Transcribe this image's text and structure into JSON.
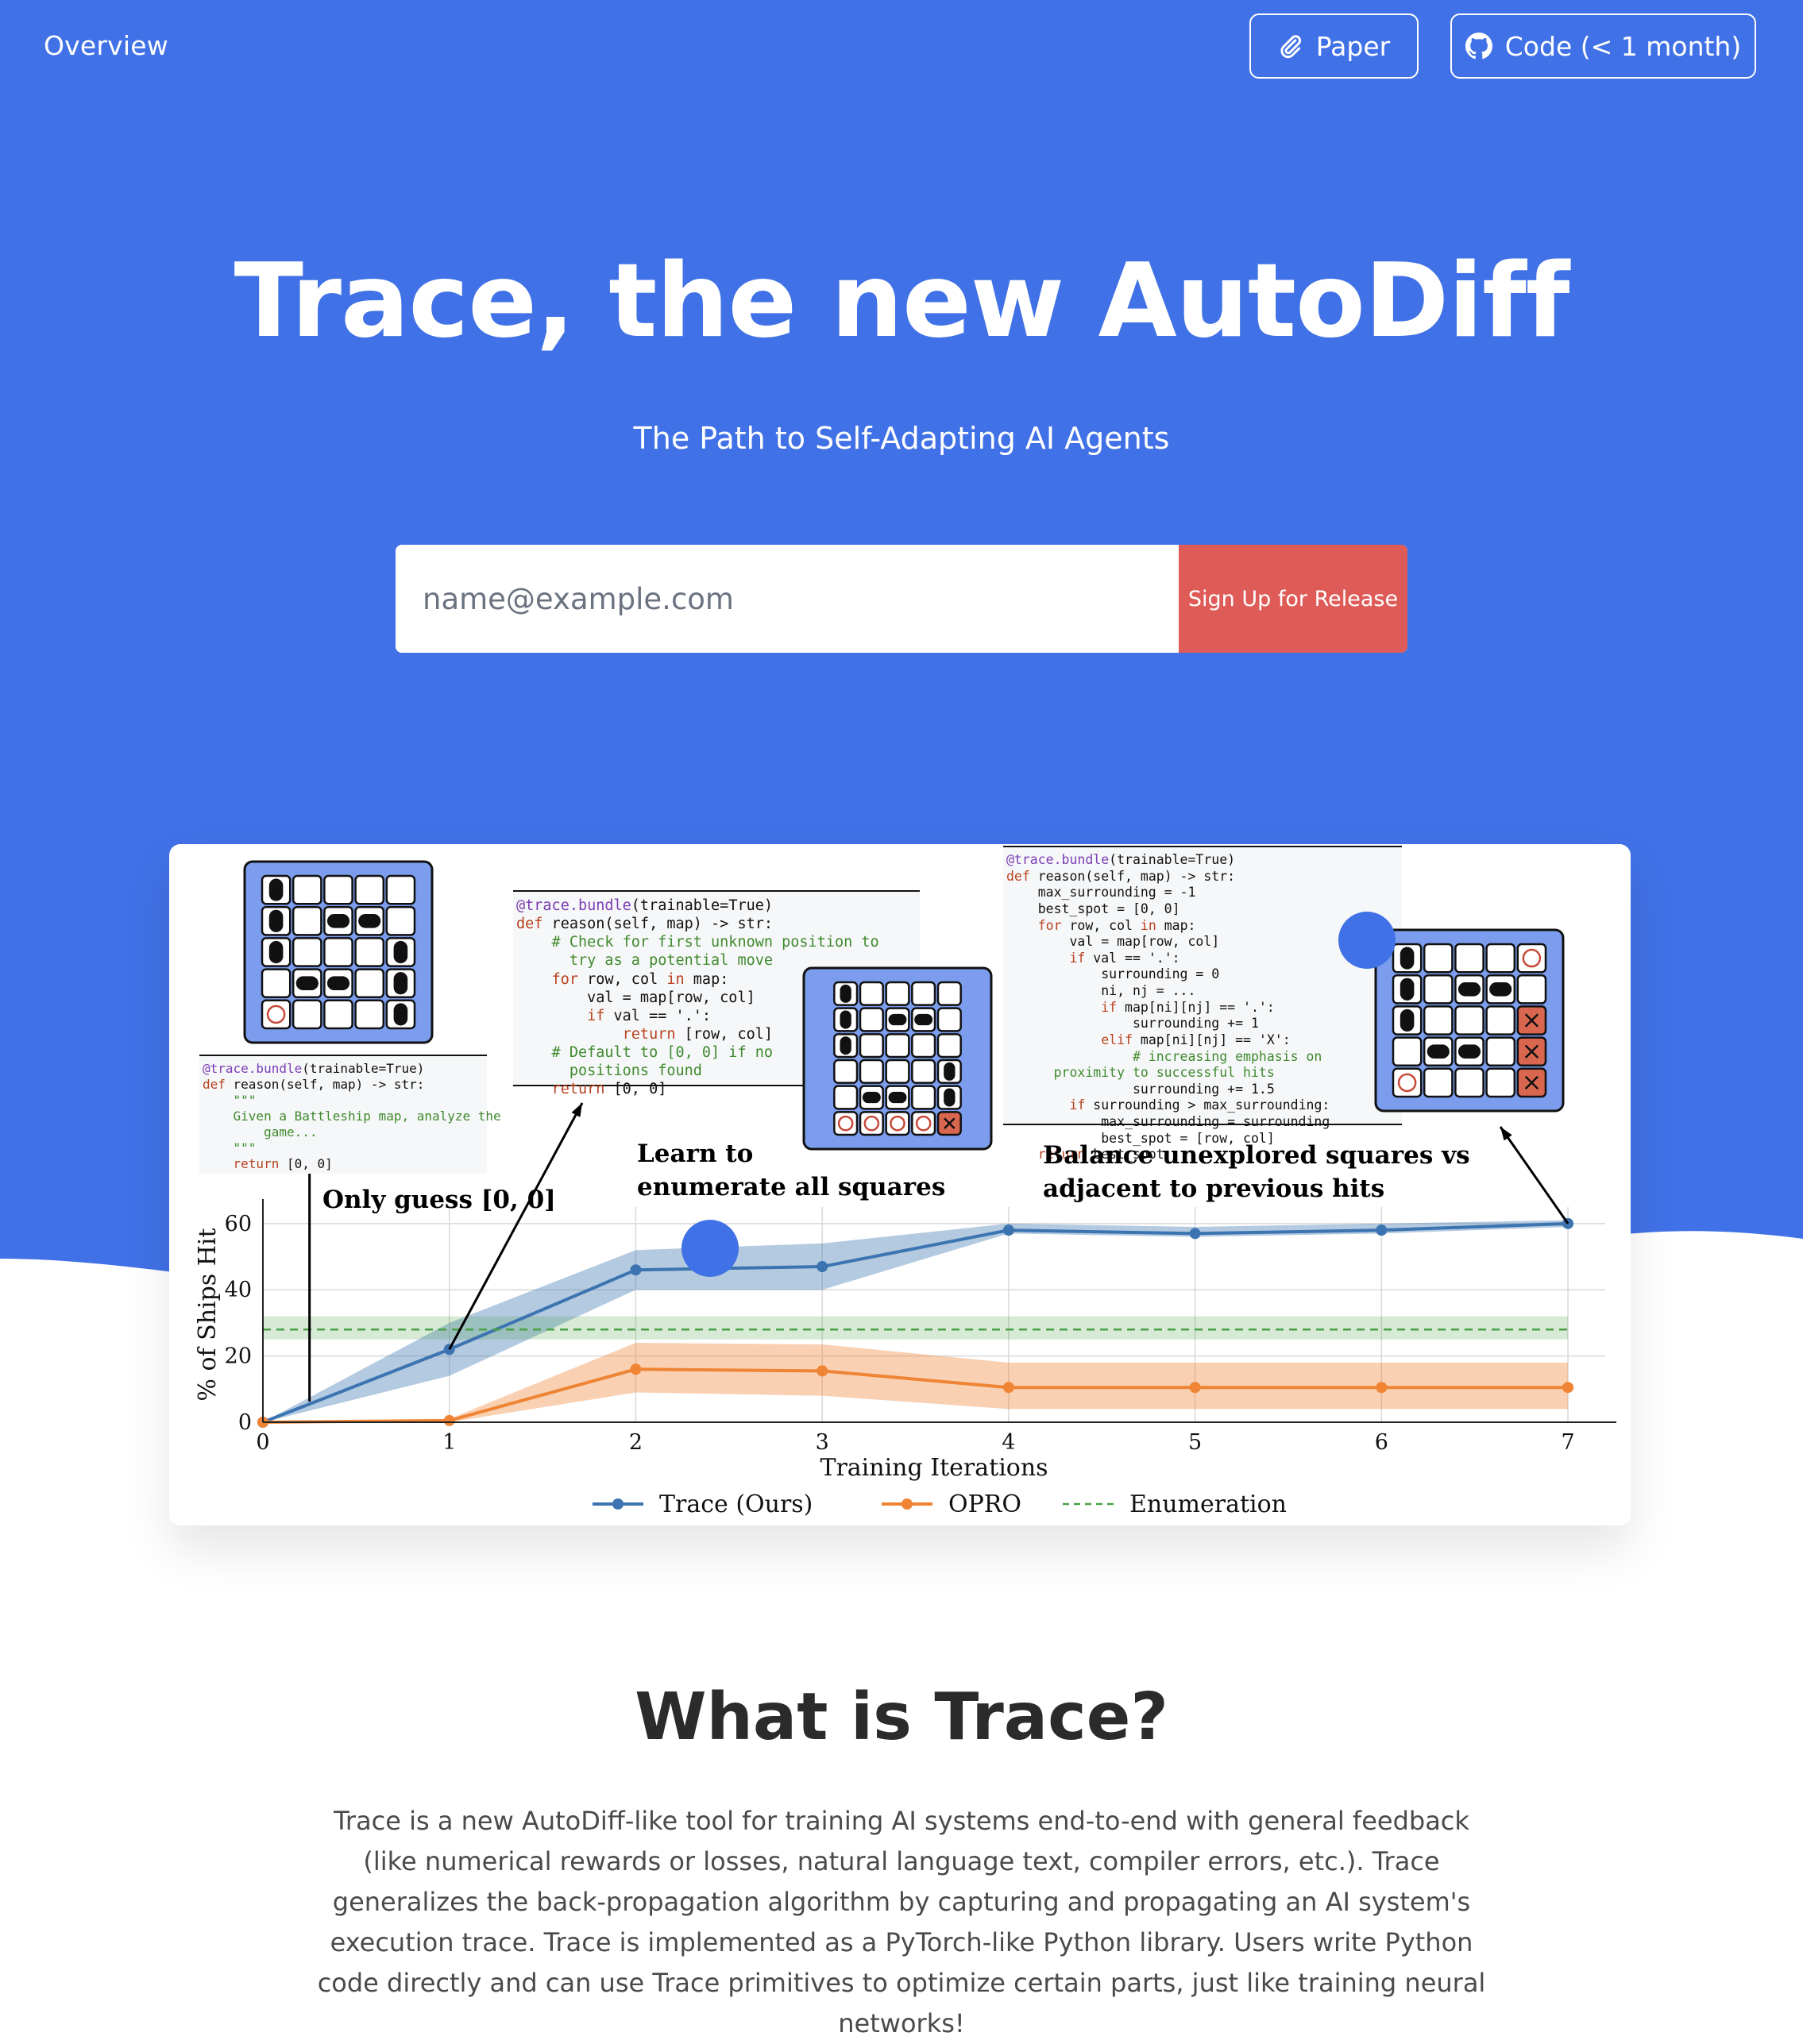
{
  "colors": {
    "hero_blue": "#4171e6",
    "cta_red": "#df5b57",
    "trace_blue": "#3b74b0",
    "opro_orange": "#ee8434",
    "enum_green": "#49a046"
  },
  "nav": {
    "overview": "Overview",
    "paper": {
      "label": "Paper",
      "icon": "paperclip-icon"
    },
    "code": {
      "label": "Code (< 1 month)",
      "icon": "github-icon"
    }
  },
  "hero": {
    "title": "Trace, the new AutoDiff",
    "subtitle": "The Path to Self-Adapting AI Agents",
    "email_placeholder": "name@example.com",
    "signup_button": "Sign Up for Release"
  },
  "figure": {
    "annotations": {
      "only_guess": "Only guess [0, 0]",
      "learn_1": "Learn to",
      "learn_2": "enumerate all squares",
      "balance_1": "Balance unexplored squares vs",
      "balance_2": "adjacent to previous hits"
    }
  },
  "chart_data": {
    "type": "line",
    "xlabel": "Training Iterations",
    "ylabel": "% of Ships Hit",
    "x": [
      0,
      1,
      2,
      3,
      4,
      5,
      6,
      7
    ],
    "xlim": [
      0,
      7.2
    ],
    "ylim": [
      0,
      65
    ],
    "yticks": [
      0,
      20,
      40,
      60
    ],
    "grid": true,
    "legend_position": "bottom",
    "series": [
      {
        "name": "Trace (Ours)",
        "values": [
          0,
          22,
          46,
          47,
          58,
          57,
          58,
          60
        ],
        "band_low": [
          0,
          14,
          40,
          40,
          57,
          56,
          57,
          59
        ],
        "band_high": [
          0,
          30,
          52,
          54,
          60,
          59,
          60,
          61
        ],
        "color": "#3b74b0",
        "style": "solid-marker"
      },
      {
        "name": "OPRO",
        "values": [
          0,
          0.5,
          16,
          15.5,
          10.5,
          10.5,
          10.5,
          10.5
        ],
        "band_low": [
          0,
          0,
          9,
          8,
          4,
          4,
          4,
          4
        ],
        "band_high": [
          0,
          1,
          24,
          23.5,
          18,
          18,
          18,
          18
        ],
        "color": "#ee8434",
        "style": "solid-marker"
      },
      {
        "name": "Enumeration",
        "values": [
          28,
          28,
          28,
          28,
          28,
          28,
          28,
          28
        ],
        "band_low": [
          25,
          25,
          25,
          25,
          25,
          25,
          25,
          25
        ],
        "band_high": [
          32,
          32,
          32,
          32,
          32,
          32,
          32,
          32
        ],
        "color": "#49a046",
        "style": "dashed"
      }
    ]
  },
  "section": {
    "title": "What is Trace?",
    "body": "Trace is a new AutoDiff-like tool for training AI systems end-to-end with general feedback (like numerical rewards or losses, natural language text, compiler errors, etc.). Trace generalizes the back-propagation algorithm by capturing and propagating an AI system's execution trace. Trace is implemented as a PyTorch-like Python library. Users write Python code directly and can use Trace primitives to optimize certain parts, just like training neural networks!"
  },
  "code": {
    "left": [
      "@trace.bundle(trainable=True)",
      "def reason(self, map) -> str:",
      "    \"\"\"",
      "    Given a Battleship map, analyze the",
      "        game...",
      "    \"\"\"",
      "    return [0, 0]"
    ],
    "middle": [
      "@trace.bundle(trainable=True)",
      "def reason(self, map) -> str:",
      "    # Check for first unknown position to",
      "      try as a potential move",
      "    for row, col in map:",
      "        val = map[row, col]",
      "        if val == '.':",
      "            return [row, col]",
      "    # Default to [0, 0] if no",
      "      positions found",
      "    return [0, 0]"
    ],
    "right": [
      "@trace.bundle(trainable=True)",
      "def reason(self, map) -> str:",
      "    max_surrounding = -1",
      "    best_spot = [0, 0]",
      "    for row, col in map:",
      "        val = map[row, col]",
      "        if val == '.':",
      "            surrounding = 0",
      "            ni, nj = ...",
      "            if map[ni][nj] == '.':",
      "                surrounding += 1",
      "            elif map[ni][nj] == 'X':",
      "                # increasing emphasis on",
      "      proximity to successful hits",
      "                surrounding += 1.5",
      "        if surrounding > max_surrounding:",
      "            max_surrounding = surrounding",
      "            best_spot = [row, col]",
      "    return best_spot"
    ]
  }
}
